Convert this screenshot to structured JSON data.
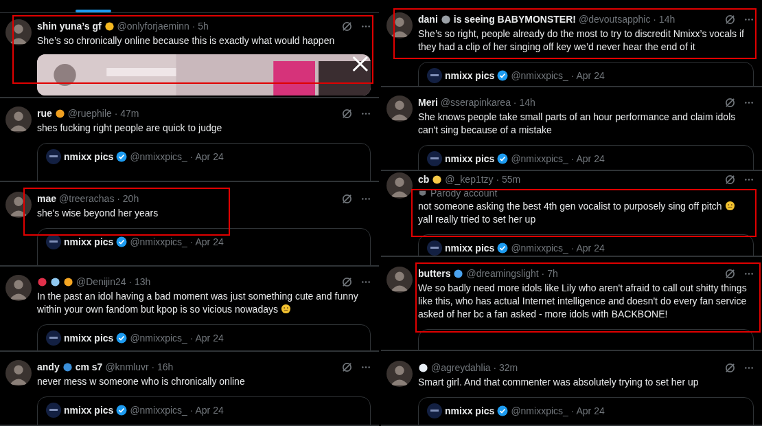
{
  "columns": [
    {
      "tweets": [
        {
          "name": [
            {
              "kind": "text",
              "text": "shin yuna’s gf"
            },
            {
              "kind": "icon"
            }
          ],
          "meta": "@onlyforjaeminn · 5h",
          "lines": [
            {
              "text": "She’s so chronically online  because this is exactly what would happen",
              "emoji": false
            }
          ],
          "media": {
            "kind": "picture"
          },
          "highlighted": true
        },
        {
          "name": [
            {
              "kind": "text",
              "text": "rue"
            },
            {
              "kind": "icon"
            }
          ],
          "meta": "@ruephile · 47m",
          "lines": [
            {
              "text": "shes fucking right people are quick to judge",
              "emoji": false
            }
          ],
          "quote": {
            "kind": "shown",
            "name": "nmixx pics",
            "meta": "@nmixxpics_ · Apr 24",
            "verified": true
          },
          "highlighted": false
        },
        {
          "name": [
            {
              "kind": "text",
              "text": "mae"
            }
          ],
          "meta": "@treerachas · 20h",
          "lines": [
            {
              "text": "she's wise beyond her years",
              "emoji": false
            }
          ],
          "quote": {
            "kind": "shown",
            "name": "nmixx pics",
            "meta": "@nmixxpics_ · Apr 24",
            "verified": true
          },
          "highlighted": true
        },
        {
          "name": [
            {
              "kind": "icon"
            },
            {
              "kind": "icon"
            },
            {
              "kind": "icon"
            }
          ],
          "meta": "@Denijin24 · 13h",
          "lines": [
            {
              "text": "In the past an idol having a bad moment was just something cute and funny",
              "emoji": false
            },
            {
              "text": "within your own fandom but kpop is so vicious nowadays",
              "emoji": true
            }
          ],
          "quote": {
            "kind": "shown",
            "name": "nmixx pics",
            "meta": "@nmixxpics_ · Apr 24",
            "verified": true
          },
          "highlighted": false
        },
        {
          "name": [
            {
              "kind": "text",
              "text": "andy"
            },
            {
              "kind": "icon"
            },
            {
              "kind": "text",
              "text": "cm s7"
            }
          ],
          "meta": "@knmluvr · 16h",
          "lines": [
            {
              "text": "never mess w someone who is chronically online",
              "emoji": false
            }
          ],
          "quote": {
            "kind": "shown",
            "name": "nmixx pics",
            "meta": "@nmixxpics_ · Apr 24",
            "verified": true
          },
          "highlighted": false
        }
      ]
    },
    {
      "tweets": [
        {
          "name": [
            {
              "kind": "text",
              "text": "dani"
            },
            {
              "kind": "icon"
            },
            {
              "kind": "text",
              "text": "is seeing BABYMONSTER!"
            }
          ],
          "meta": "@devoutsapphic · 14h",
          "lines": [
            {
              "text": "She’s so right, people already do the most to try to discredit Nmixx’s vocals if they had a clip of her singing off key we’d never hear the end of it",
              "emoji": false
            }
          ],
          "quote": {
            "kind": "shown",
            "name": "nmixx pics",
            "meta": "@nmixxpics_ · Apr 24",
            "verified": true
          },
          "highlighted": true
        },
        {
          "name": [
            {
              "kind": "text",
              "text": "Meri"
            }
          ],
          "meta": "@sserapinkarea · 14h",
          "lines": [
            {
              "text": "She knows people take small parts of an hour performance and claim idols can't sing because of a mistake",
              "emoji": false
            }
          ],
          "quote": {
            "kind": "shown",
            "name": "nmixx pics",
            "meta": "@nmixxpics_ · Apr 24",
            "verified": true
          },
          "highlighted": false
        },
        {
          "name": [
            {
              "kind": "text",
              "text": "cb"
            },
            {
              "kind": "icon"
            }
          ],
          "meta": "@_kep1tzy · 55m",
          "label": "Parody account",
          "lines": [
            {
              "text": "not someone asking the best 4th gen vocalist to purposely sing off pitch",
              "emoji": true
            },
            {
              "text": "yall really tried to set her up",
              "emoji": false
            }
          ],
          "quote": {
            "kind": "shown",
            "name": "nmixx pics",
            "meta": "@nmixxpics_ · Apr 24",
            "verified": true
          },
          "highlighted": true
        },
        {
          "name": [
            {
              "kind": "text",
              "text": "butters"
            },
            {
              "kind": "icon"
            }
          ],
          "meta": "@dreamingslight · 7h",
          "lines": [
            {
              "text": "We so badly need more idols like Lily who aren't afraid to call out shitty things like this, who has actual Internet intelligence and doesn't do every fan service asked of her bc a fan asked - more idols with BACKBONE!",
              "emoji": false
            }
          ],
          "quote": {
            "kind": "hidden"
          },
          "highlighted": true
        },
        {
          "name": [
            {
              "kind": "icon"
            }
          ],
          "meta": "@agreydahlia · 32m",
          "lines": [
            {
              "text": "Smart girl. And that commenter was absolutely trying to set her up",
              "emoji": false
            }
          ],
          "quote": {
            "kind": "shown",
            "name": "nmixx pics",
            "meta": "@nmixxpics_ · Apr 24",
            "verified": true
          },
          "highlighted": false
        }
      ]
    }
  ]
}
